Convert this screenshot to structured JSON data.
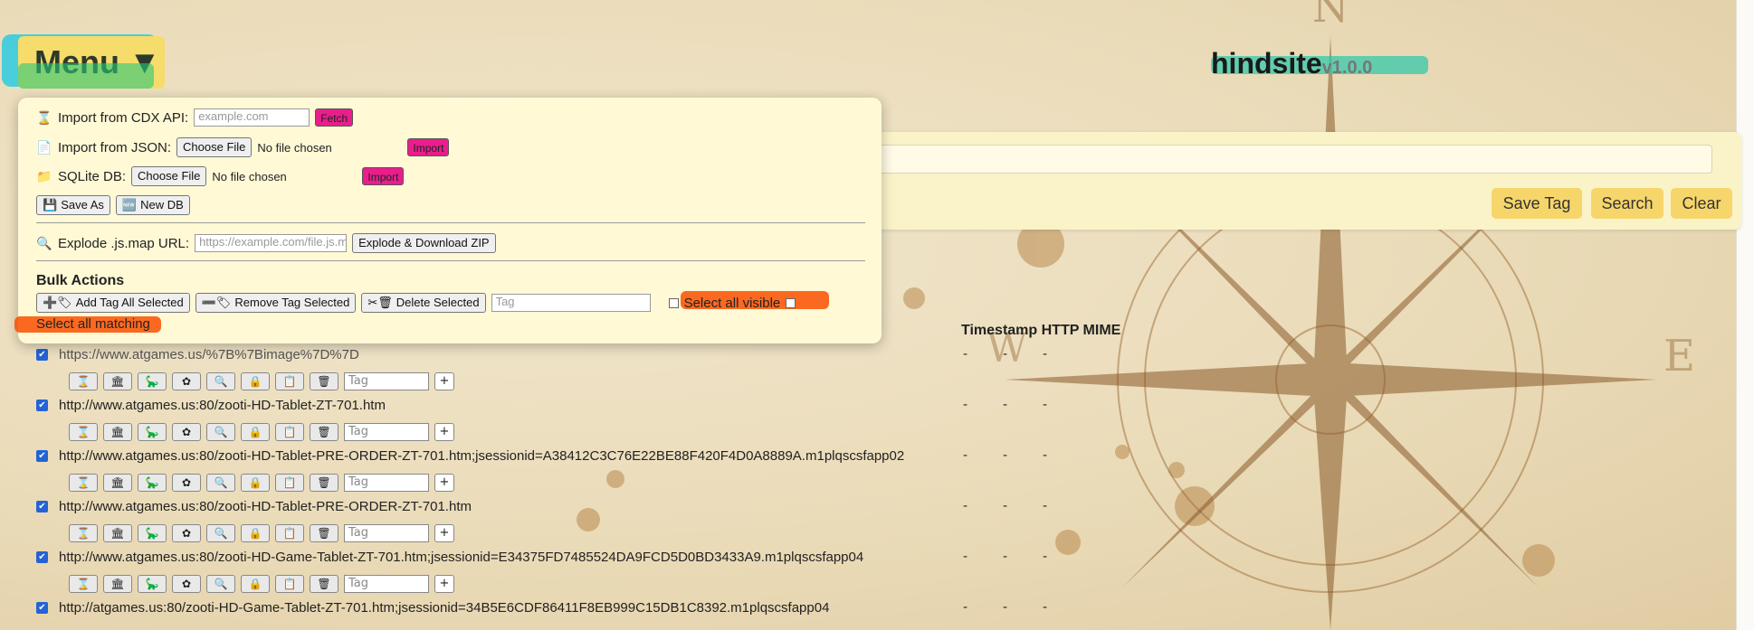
{
  "header": {
    "menu_label": "Menu ▼",
    "brand_name": "hindsite",
    "brand_version": "v1.0.0"
  },
  "search": {
    "save_tag": "Save Tag",
    "search": "Search",
    "clear": "Clear"
  },
  "menu": {
    "cdx_label": "Import from CDX API:",
    "cdx_placeholder": "example.com",
    "fetch": "Fetch",
    "json_label": "Import from JSON:",
    "choose_file": "Choose File",
    "no_file": "No file chosen",
    "import": "Import",
    "sqlite_label": "SQLite DB:",
    "save_as": "Save As",
    "new_db": "New DB",
    "explode_label": "Explode .js.map URL:",
    "explode_placeholder": "https://example.com/file.js.map",
    "explode_button": "Explode & Download ZIP",
    "bulk_title": "Bulk Actions",
    "add_tag_all": "Add Tag All Selected",
    "remove_tag": "Remove Tag Selected",
    "delete_selected": "Delete Selected",
    "tag_placeholder": "Tag",
    "select_all_visible": "Select all visible",
    "select_all_matching": "Select all matching"
  },
  "table": {
    "headers": "Timestamp HTTP MIME",
    "tag_placeholder": "Tag",
    "plus": "+",
    "dash": "-",
    "rows": [
      {
        "url": "https://www.atgames.us/%7B%7Bimage%7D%7D"
      },
      {
        "url": "http://www.atgames.us:80/zooti-HD-Tablet-ZT-701.htm"
      },
      {
        "url": "http://www.atgames.us:80/zooti-HD-Tablet-PRE-ORDER-ZT-701.htm;jsessionid=A38412C3C76E22BE88F420F4D0A8889A.m1plqscsfapp02"
      },
      {
        "url": "http://www.atgames.us:80/zooti-HD-Tablet-PRE-ORDER-ZT-701.htm"
      },
      {
        "url": "http://www.atgames.us:80/zooti-HD-Game-Tablet-ZT-701.htm;jsessionid=E34375FD7485524DA9FCD5D0BD3433A9.m1plqscsfapp04"
      },
      {
        "url": "http://atgames.us:80/zooti-HD-Game-Tablet-ZT-701.htm;jsessionid=34B5E6CDF86411F8EB999C15DB1C8392.m1plqscsfapp04"
      }
    ]
  },
  "icons": [
    "hourglass-icon",
    "wayback-icon",
    "dino-icon",
    "flower-icon",
    "magnifier-icon",
    "lock-icon",
    "clipboard-icon",
    "trash-icon"
  ]
}
